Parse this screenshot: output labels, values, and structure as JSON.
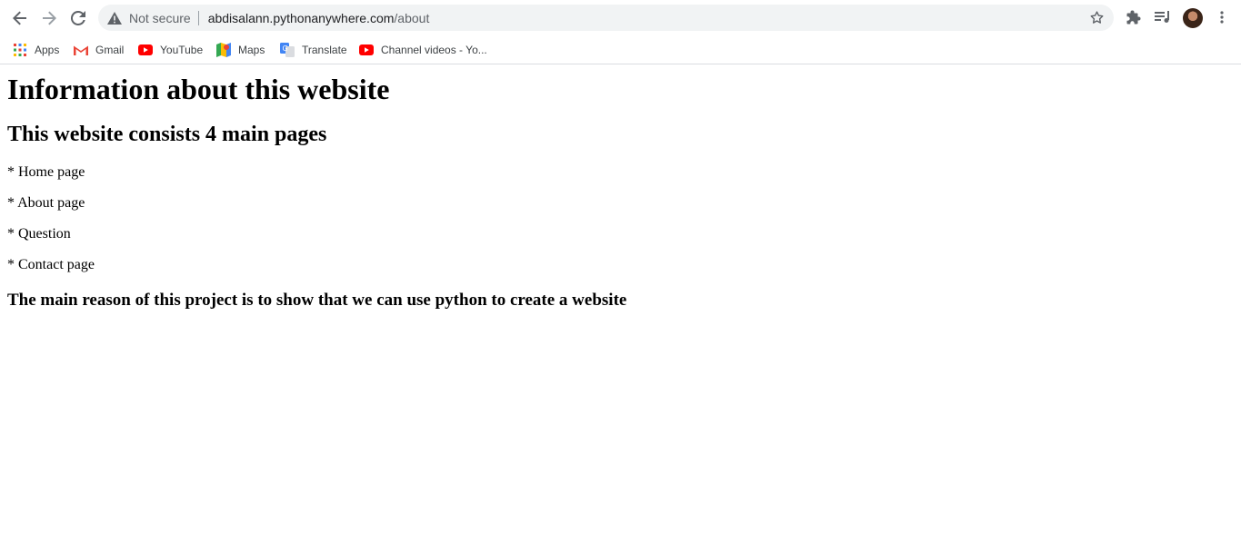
{
  "browser": {
    "security_label": "Not secure",
    "url_host": "abdisalann.pythonanywhere.com",
    "url_path": "/about",
    "icons": {
      "back": "back-arrow-icon",
      "forward": "forward-arrow-icon",
      "reload": "reload-icon",
      "warning": "warning-icon",
      "bookmark": "star-icon",
      "extensions": "puzzle-icon",
      "media": "playlist-icon",
      "menu": "kebab-menu-icon"
    },
    "bookmarks": [
      {
        "label": "Apps",
        "icon": "apps-grid-icon"
      },
      {
        "label": "Gmail",
        "icon": "gmail-icon"
      },
      {
        "label": "YouTube",
        "icon": "youtube-icon"
      },
      {
        "label": "Maps",
        "icon": "maps-icon"
      },
      {
        "label": "Translate",
        "icon": "translate-icon"
      },
      {
        "label": "Channel videos - Yo...",
        "icon": "youtube-icon"
      }
    ]
  },
  "page": {
    "title": "Information about this website",
    "subtitle": "This website consists 4 main pages",
    "items": [
      "* Home page",
      "* About page",
      "* Question",
      "* Contact page"
    ],
    "footer": "The main reason of this project is to show that we can use python to create a website"
  }
}
